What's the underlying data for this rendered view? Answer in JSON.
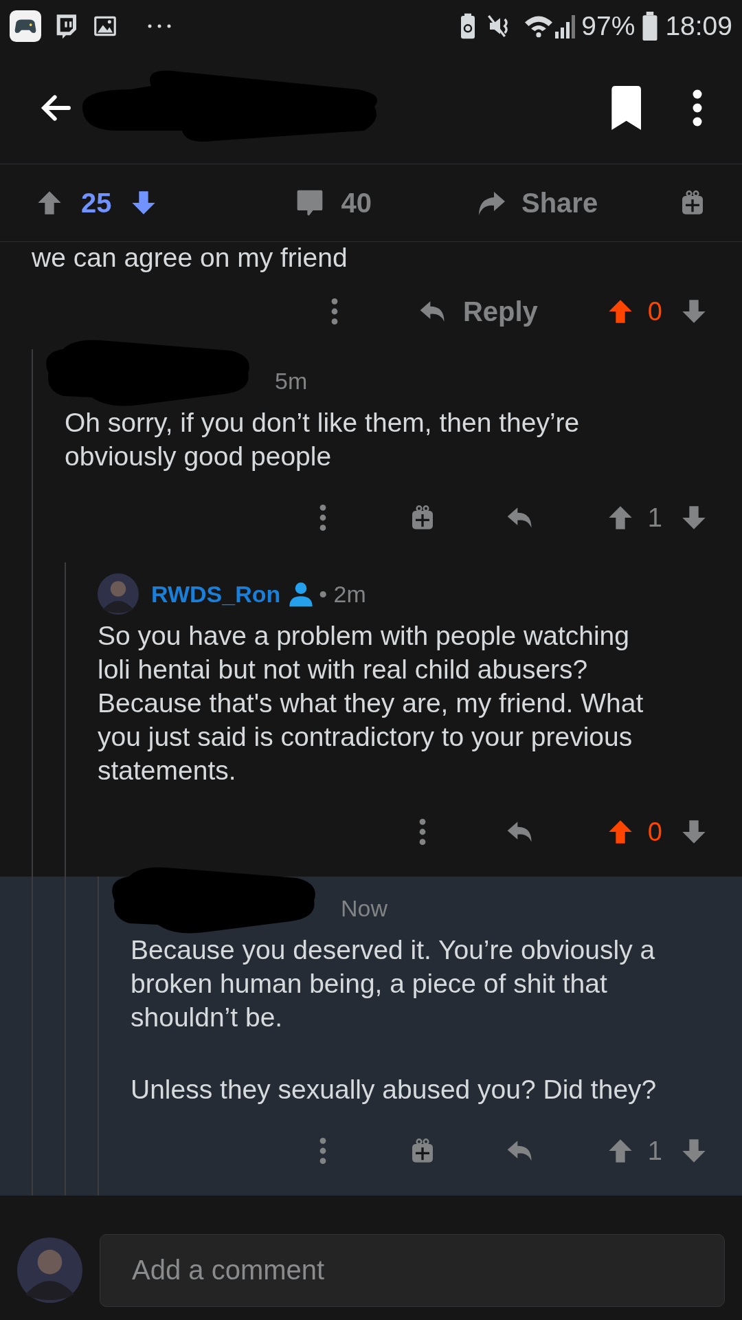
{
  "status_bar": {
    "battery": "97%",
    "time": "18:09"
  },
  "post_bar": {
    "upvoted": false,
    "downvoted": true,
    "score": "25",
    "comments": "40",
    "share": "Share"
  },
  "comments": [
    {
      "kind": "clipped",
      "body": [
        "we can agree on my friend"
      ],
      "reply_label": "Reply",
      "gift": false,
      "upvoted": true,
      "downvoted": false,
      "score": "0",
      "highlighted": false,
      "children": [
        {
          "kind": "comment",
          "redacted": true,
          "time": "5m",
          "body": [
            "Oh sorry, if you don’t like them, then they’re obviously good people"
          ],
          "gift": true,
          "upvoted": false,
          "downvoted": false,
          "score": "1",
          "highlighted": false,
          "children": [
            {
              "kind": "comment",
              "redacted": false,
              "author": "RWDS_Ron",
              "time": "• 2m",
              "body": [
                "So you have a problem with people watching loli hentai but not with real child abusers? Because that's what they are, my friend. What you just said is contradictory to your previous statements."
              ],
              "gift": false,
              "upvoted": true,
              "downvoted": false,
              "score": "0",
              "highlighted": false,
              "children": [
                {
                  "kind": "comment",
                  "redacted": true,
                  "time": "Now",
                  "body": [
                    "Because you deserved it. You’re obviously a broken human being, a piece of shit that shouldn’t be.",
                    "Unless they sexually abused you? Did they?"
                  ],
                  "gift": true,
                  "upvoted": false,
                  "downvoted": false,
                  "score": "1",
                  "highlighted": true
                }
              ]
            }
          ]
        }
      ]
    }
  ],
  "composer": {
    "placeholder": "Add a comment"
  }
}
